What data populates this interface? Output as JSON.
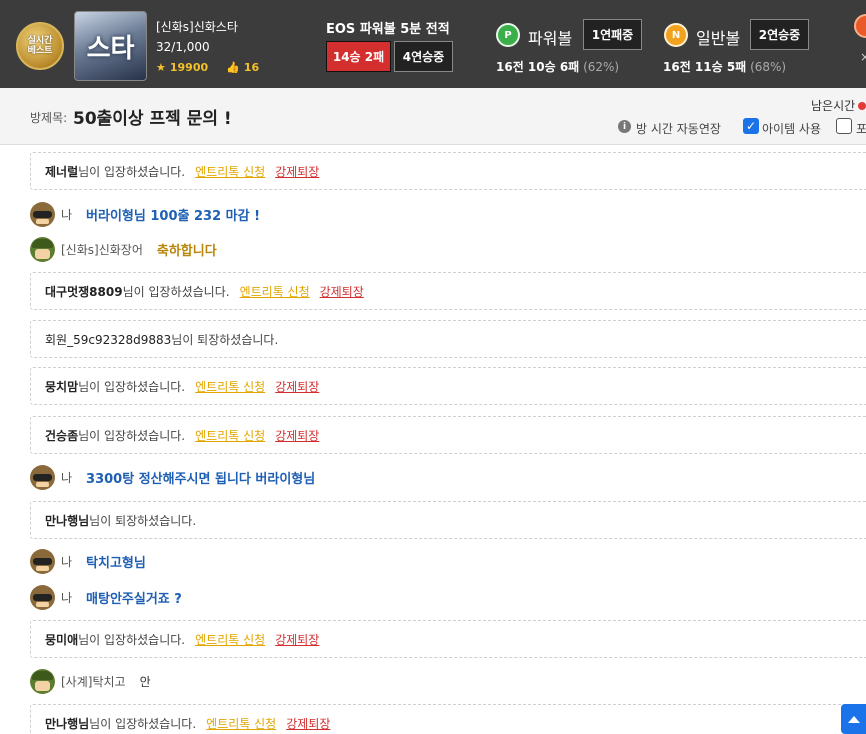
{
  "header": {
    "live_badge": "실시간\n베스트",
    "room_thumb_text": "스타",
    "host_name": "[신화s]신화스타",
    "member_count": "32/1,000",
    "stars": "19900",
    "likes": "16",
    "eos": {
      "title": "EOS 파워볼 5분 전적",
      "win_loss": "14승 2패",
      "streak": "4연승중"
    },
    "powerball": {
      "icon_letter": "P",
      "label": "파워볼",
      "state": "1연패중",
      "record_prefix": "16전 10승 6패",
      "record_pct": "(62%)"
    },
    "normalball": {
      "icon_letter": "N",
      "label": "일반볼",
      "state": "2연승중",
      "record_prefix": "16전 11승 5패",
      "record_pct": "(68%)"
    },
    "close_glyph": "×"
  },
  "room": {
    "label": "방제목:",
    "title": "50출이상 프젝 문의 !",
    "time_left_label": "남은시간",
    "auto_extend": "방 시간 자동연장",
    "item_use": "아이템 사용",
    "second_option": "포"
  },
  "chat": {
    "enter_suffix": "님이 입장하셨습니다.",
    "leave_suffix": "님이 퇴장하셨습니다.",
    "entry_link": "엔트리톡 신청",
    "kick_link": "강제퇴장",
    "me_label": "나",
    "entries": [
      {
        "nick": "제너럴"
      },
      {
        "sender": "나",
        "text": "버라이형님 100출 232 마감 !"
      },
      {
        "sender": "[신화s]신화장어",
        "text": "축하합니다"
      },
      {
        "nick": "대구멋쟁8809"
      },
      {
        "nick": "회원_59c92328d9883"
      },
      {
        "nick": "뭉치맘"
      },
      {
        "nick": "건승좀"
      },
      {
        "sender": "나",
        "text": "3300탕 정산해주시면 됩니다 버라이형님"
      },
      {
        "nick": "만나행님"
      },
      {
        "sender": "나",
        "text": "탁치고형님"
      },
      {
        "sender": "나",
        "text": "매탕안주실거죠 ?"
      },
      {
        "nick": "뭉미애"
      },
      {
        "sender": "[사계]탁치고",
        "text": "안"
      },
      {
        "nick": "만나행님"
      }
    ]
  },
  "colors": {
    "header_bg": "#3c3c3c",
    "win_red": "#d32f2f",
    "my_text": "#1e5fb4",
    "other_text": "#b8860b",
    "entry_link": "#e2a500",
    "accent_blue": "#1a73e8"
  }
}
